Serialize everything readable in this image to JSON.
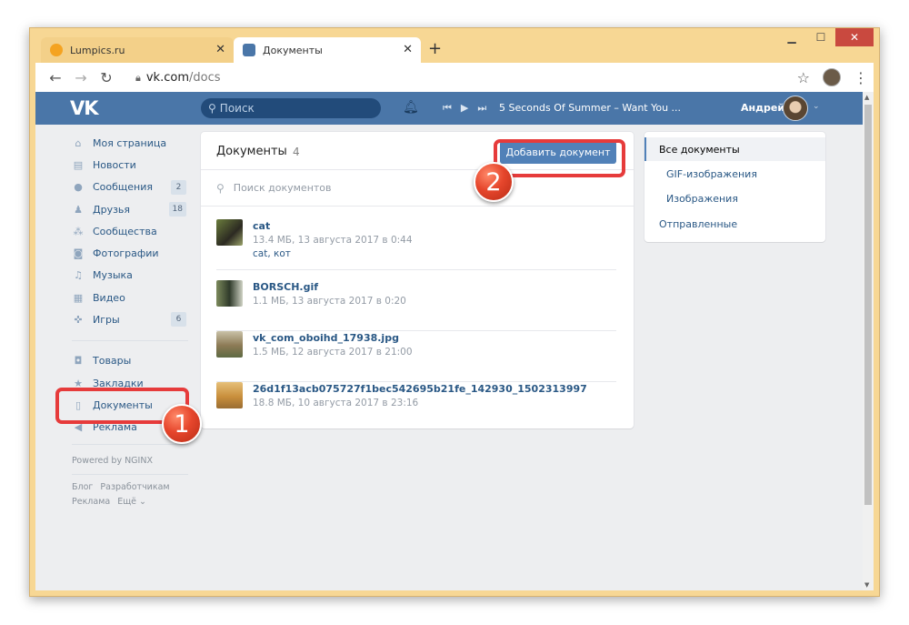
{
  "browser": {
    "tabs": [
      {
        "title": "Lumpics.ru",
        "favicon_color": "#f4a321"
      },
      {
        "title": "Документы",
        "favicon_color": "#4a76a8"
      }
    ],
    "new_tab": "+",
    "url_host": "vk.com",
    "url_path": "/docs"
  },
  "vk": {
    "logo": "VK",
    "search_placeholder": "Поиск",
    "now_playing": "5 Seconds Of Summer – Want You ...",
    "user_name": "Андрей"
  },
  "sidebar": {
    "items": [
      {
        "label": "Моя страница",
        "icon": "home-icon",
        "badge": ""
      },
      {
        "label": "Новости",
        "icon": "news-icon",
        "badge": ""
      },
      {
        "label": "Сообщения",
        "icon": "messages-icon",
        "badge": "2"
      },
      {
        "label": "Друзья",
        "icon": "friends-icon",
        "badge": "18"
      },
      {
        "label": "Сообщества",
        "icon": "groups-icon",
        "badge": ""
      },
      {
        "label": "Фотографии",
        "icon": "camera-icon",
        "badge": ""
      },
      {
        "label": "Музыка",
        "icon": "music-icon",
        "badge": ""
      },
      {
        "label": "Видео",
        "icon": "video-icon",
        "badge": ""
      },
      {
        "label": "Игры",
        "icon": "gamepad-icon",
        "badge": "6"
      }
    ],
    "items2": [
      {
        "label": "Товары",
        "icon": "bag-icon"
      },
      {
        "label": "Закладки",
        "icon": "star-icon"
      },
      {
        "label": "Документы",
        "icon": "document-icon"
      },
      {
        "label": "Реклама",
        "icon": "megaphone-icon"
      }
    ],
    "powered": "Powered by NGINX",
    "footer_links": [
      "Блог",
      "Разработчикам",
      "Реклама",
      "Ещё ⌄"
    ]
  },
  "docs": {
    "title": "Документы",
    "count": "4",
    "add_button": "Добавить документ",
    "search_placeholder": "Поиск документов",
    "items": [
      {
        "name": "cat",
        "meta": "13.4 МБ, 13 августа 2017 в 0:44",
        "tags": "cat, кот"
      },
      {
        "name": "BORSCH.gif",
        "meta": "1.1 МБ, 13 августа 2017 в 0:20",
        "tags": ""
      },
      {
        "name": "vk_com_oboihd_17938.jpg",
        "meta": "1.5 МБ, 12 августа 2017 в 21:00",
        "tags": ""
      },
      {
        "name": "26d1f13acb075727f1bec542695b21fe_142930_1502313997",
        "meta": "18.8 МБ, 10 августа 2017 в 23:16",
        "tags": ""
      }
    ]
  },
  "filters": {
    "items": [
      "Все документы",
      "GIF-изображения",
      "Изображения",
      "Отправленные"
    ]
  },
  "annotations": {
    "step1": "1",
    "step2": "2",
    "highlight_color": "#e63b3b"
  }
}
